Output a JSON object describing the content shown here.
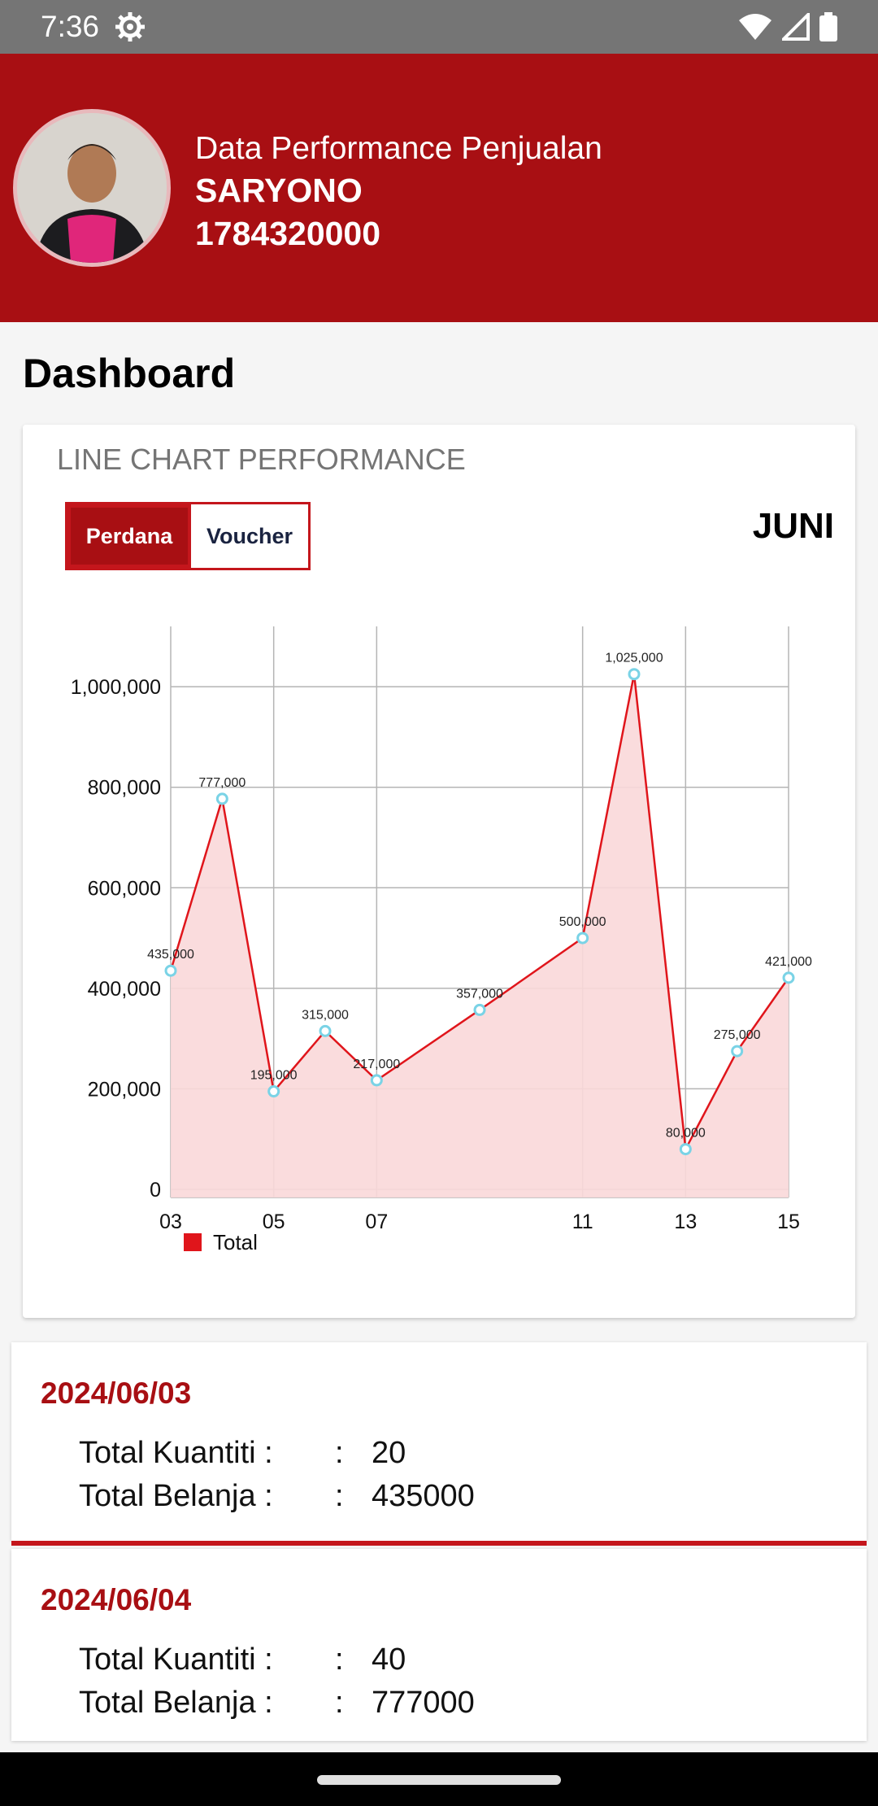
{
  "status_bar": {
    "time": "7:36"
  },
  "header": {
    "subtitle": "Data Performance Penjualan",
    "name": "SARYONO",
    "id": "1784320000"
  },
  "page_title": "Dashboard",
  "chart_card": {
    "title": "LINE CHART PERFORMANCE",
    "toggle": {
      "perdana": "Perdana",
      "voucher": "Voucher"
    },
    "month": "JUNI"
  },
  "chart_data": {
    "type": "line",
    "x": [
      3,
      4,
      5,
      6,
      7,
      9,
      11,
      12,
      13,
      14,
      15
    ],
    "values": [
      435000,
      777000,
      195000,
      315000,
      217000,
      357000,
      500000,
      1025000,
      80000,
      275000,
      421000
    ],
    "point_labels": [
      "435,000",
      "777,000",
      "195,000",
      "315,000",
      "217,000",
      "357,000",
      "500,000",
      "1,025,000",
      "80,000",
      "275,000",
      "421,000"
    ],
    "x_tick_labels": [
      "03",
      "05",
      "07",
      "11",
      "13",
      "15"
    ],
    "y_ticks": [
      0,
      200000,
      400000,
      600000,
      800000,
      1000000
    ],
    "y_tick_labels": [
      "0",
      "200,000",
      "400,000",
      "600,000",
      "800,000",
      "1,000,000"
    ],
    "ylim": [
      0,
      1120000
    ],
    "legend": "Total",
    "grid": true,
    "colors": {
      "line": "#e0151b",
      "fill": "#f9d8d9",
      "marker": "#7ad3e6"
    }
  },
  "entries": [
    {
      "date": "2024/06/03",
      "qty_label": "Total Kuantiti :",
      "qty": "20",
      "spend_label": "Total Belanja :",
      "spend": "435000"
    },
    {
      "date": "2024/06/04",
      "qty_label": "Total Kuantiti :",
      "qty": "40",
      "spend_label": "Total Belanja :",
      "spend": "777000"
    }
  ],
  "colon": ":"
}
